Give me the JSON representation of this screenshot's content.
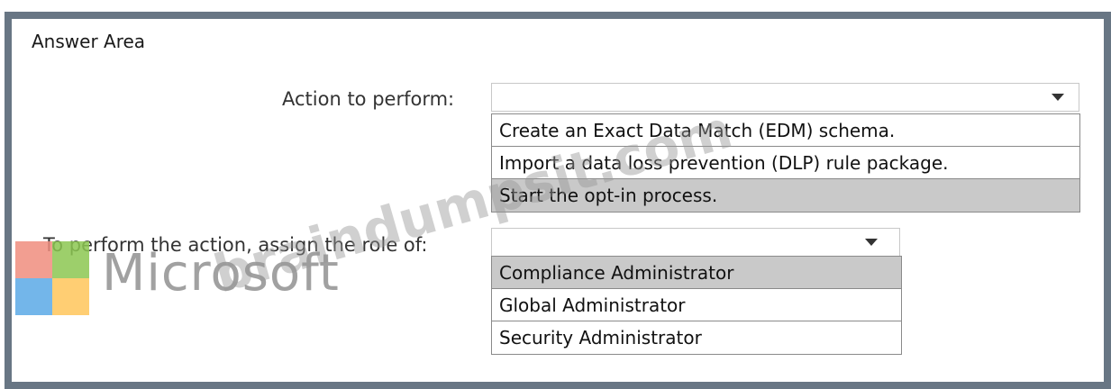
{
  "page": {
    "title": "Answer Area"
  },
  "questions": [
    {
      "label": "Action to perform:",
      "selected": "",
      "options": [
        {
          "text": "Create an Exact Data Match (EDM) schema.",
          "highlighted": false
        },
        {
          "text": "Import a data loss prevention (DLP) rule package.",
          "highlighted": false
        },
        {
          "text": "Start the opt-in process.",
          "highlighted": true
        }
      ]
    },
    {
      "label": "To perform the action, assign the role of:",
      "selected": "",
      "options": [
        {
          "text": "Compliance Administrator",
          "highlighted": true
        },
        {
          "text": "Global Administrator",
          "highlighted": false
        },
        {
          "text": "Security Administrator",
          "highlighted": false
        }
      ]
    }
  ],
  "logo": {
    "text": "Microsoft",
    "colors": [
      "#f08d7e",
      "#8cc751",
      "#5aa9e6",
      "#ffc65a"
    ]
  },
  "watermark": {
    "text": "braindumpsit.com"
  }
}
